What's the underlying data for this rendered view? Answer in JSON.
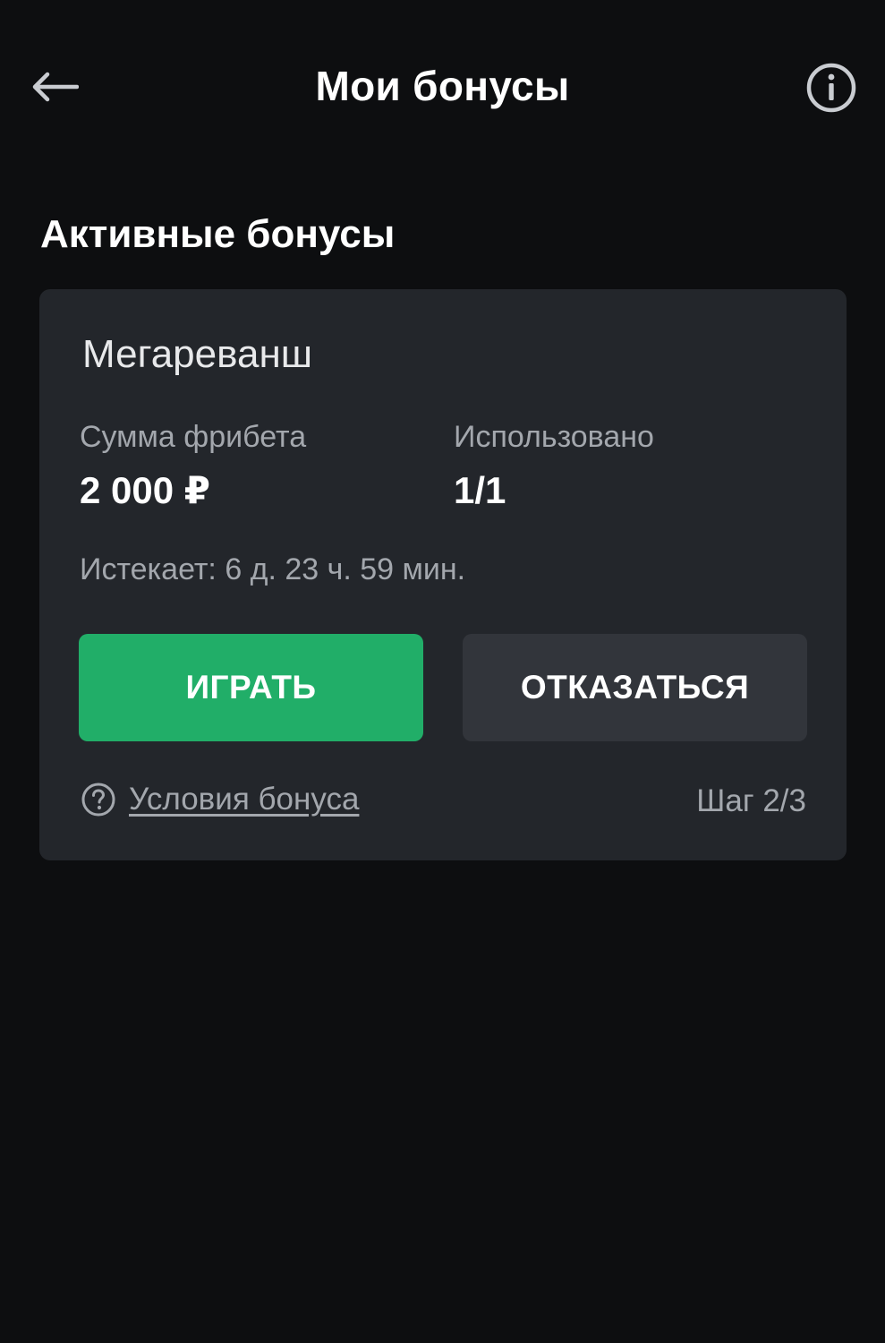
{
  "header": {
    "title": "Мои бонусы",
    "back_icon": "arrow-left-icon",
    "info_icon": "info-circle-icon"
  },
  "section": {
    "title": "Активные бонусы"
  },
  "bonus_card": {
    "title": "Мегареванш",
    "freebet_label": "Сумма фрибета",
    "freebet_value": "2 000 ₽",
    "used_label": "Использовано",
    "used_value": "1/1",
    "expires": "Истекает: 6 д. 23 ч. 59 мин.",
    "play_label": "ИГРАТЬ",
    "decline_label": "ОТКАЗАТЬСЯ",
    "terms_label": "Условия бонуса",
    "terms_icon": "question-circle-icon",
    "step": "Шаг 2/3"
  },
  "colors": {
    "background": "#0d0e10",
    "card": "#23262b",
    "accent_green": "#21ae68",
    "secondary_button": "#32353b",
    "muted_text": "#a3a7ad"
  }
}
